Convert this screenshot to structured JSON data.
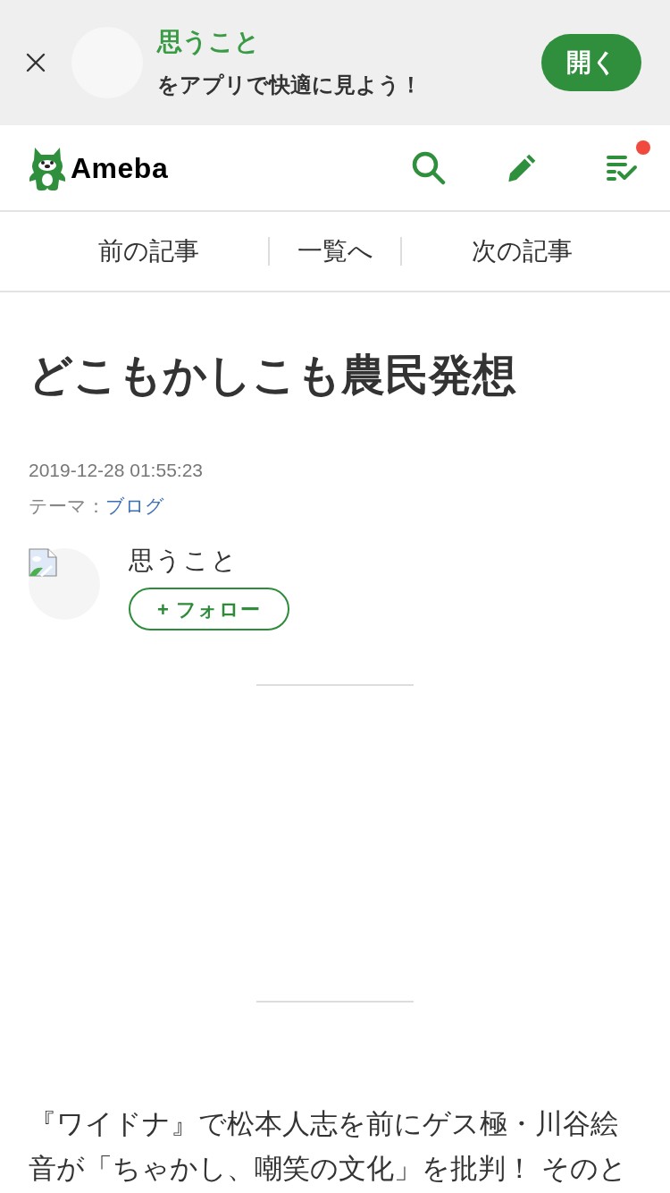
{
  "app_banner": {
    "blog_name": "思うこと",
    "message": "をアプリで快適に見よう！",
    "open_button": "開く"
  },
  "header": {
    "logo_text": "Ameba",
    "notification_badge": true
  },
  "article_nav": [
    {
      "label": "前の記事"
    },
    {
      "label": "一覧へ"
    },
    {
      "label": "次の記事"
    }
  ],
  "article": {
    "title": "どこもかしこも農民発想",
    "date": "2019-12-28 01:55:23",
    "theme_label": "テーマ：",
    "theme": "ブログ",
    "author": {
      "name": "思うこと",
      "follow_button": "+ フォロー"
    },
    "body": "『ワイドナ』で松本人志を前にゲス極・川谷絵音が「ちゃかし、嘲笑の文化」を批判！ そのと"
  }
}
